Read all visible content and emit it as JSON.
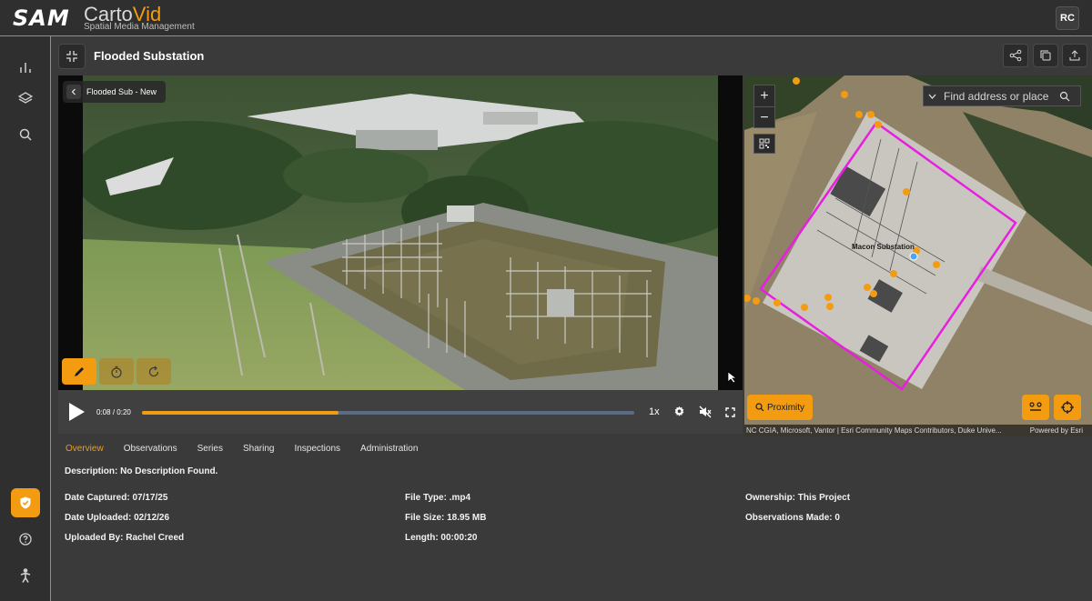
{
  "app": {
    "logo": "SAM",
    "title_part1": "Carto",
    "title_part2": "Vid",
    "subtitle": "Spatial Media Management",
    "user_initials": "RC"
  },
  "header": {
    "title": "Flooded Substation"
  },
  "video": {
    "back_label": "Flooded Sub - New",
    "current_time": "0:08",
    "separator": "/",
    "duration": "0:20",
    "progress_fraction": 0.4,
    "speed": "1x"
  },
  "map": {
    "search_placeholder": "Find address or place",
    "substation_label": "Macon Substation",
    "proximity_label": "Proximity",
    "attribution": "NC CGIA, Microsoft, Vantor | Esri Community Maps Contributors, Duke Unive...",
    "powered_by": "Powered by Esri"
  },
  "tabs": [
    "Overview",
    "Observations",
    "Series",
    "Sharing",
    "Inspections",
    "Administration"
  ],
  "overview": {
    "description": "Description: No Description Found.",
    "date_captured": "Date Captured: 07/17/25",
    "date_uploaded": "Date Uploaded: 02/12/26",
    "uploaded_by": "Uploaded By: Rachel Creed",
    "file_type": "File Type: .mp4",
    "file_size": "File Size: 18.95 MB",
    "length": "Length: 00:00:20",
    "ownership": "Ownership: This Project",
    "observations_made": "Observations Made: 0"
  },
  "colors": {
    "accent": "#f39c12",
    "boundary": "#e81ee0",
    "progress_track": "#5c6b84"
  }
}
